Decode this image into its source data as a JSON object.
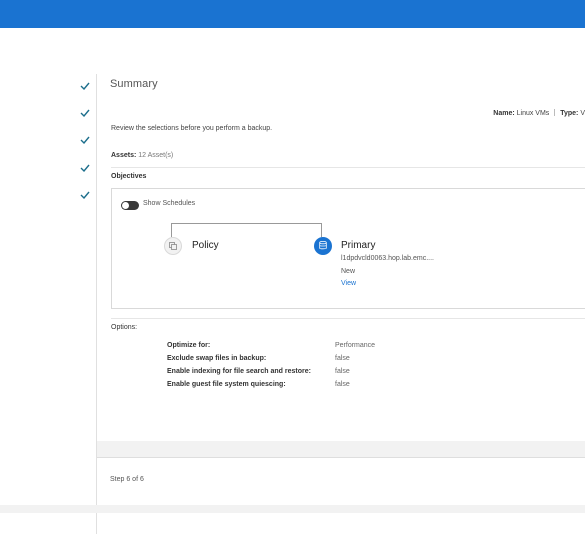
{
  "summary": {
    "title": "Summary"
  },
  "header": {
    "name_label": "Name:",
    "name_value": "Linux VMs",
    "type_label": "Type:",
    "type_value": "V"
  },
  "review_text": "Review the selections before you perform a backup.",
  "assets": {
    "label": "Assets:",
    "value": "12 Asset(s)"
  },
  "objectives": {
    "label": "Objectives",
    "toggle_label": "Show Schedules",
    "policy": {
      "title": "Policy",
      "icon": "copy-icon"
    },
    "primary": {
      "title": "Primary",
      "icon": "database-icon",
      "host": "l1dpdvcld0063.hop.lab.emc....",
      "status": "New",
      "view_link": "View"
    }
  },
  "options": {
    "label": "Options:",
    "rows": [
      {
        "key": "Optimize for:",
        "value": "Performance"
      },
      {
        "key": "Exclude swap files in backup:",
        "value": "false"
      },
      {
        "key": "Enable indexing for file search and restore:",
        "value": "false"
      },
      {
        "key": "Enable guest file system quiescing:",
        "value": "false"
      }
    ]
  },
  "footer": {
    "step": "Step 6 of 6"
  },
  "colors": {
    "brand": "#1a73d1",
    "check": "#1c6e8c"
  }
}
